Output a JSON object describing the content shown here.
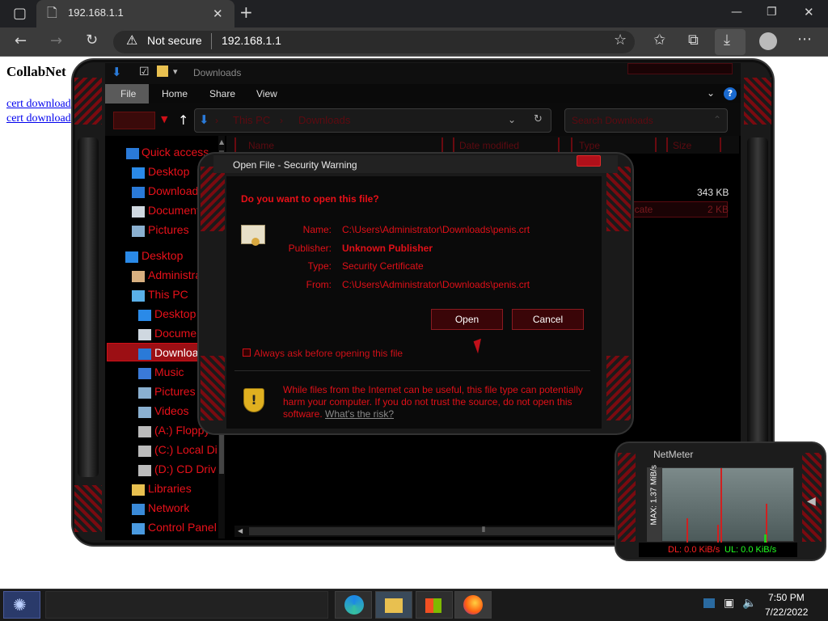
{
  "browser": {
    "tab_title": "192.168.1.1",
    "security_label": "Not secure",
    "url": "192.168.1.1"
  },
  "page": {
    "heading": "CollabNet",
    "links": [
      "cert download",
      "cert download"
    ]
  },
  "explorer": {
    "title": "Downloads",
    "ribbon_tabs": [
      "File",
      "Home",
      "Share",
      "View"
    ],
    "breadcrumb": [
      "This PC",
      "Downloads"
    ],
    "search_placeholder": "Search Downloads",
    "columns": [
      "Name",
      "Date modified",
      "Type",
      "Size"
    ],
    "nav_items": [
      {
        "label": "Quick access",
        "icon": "star-icon"
      },
      {
        "label": "Desktop",
        "icon": "desktop-icon"
      },
      {
        "label": "Downloads",
        "icon": "download-arrow-icon"
      },
      {
        "label": "Documents",
        "icon": "document-icon"
      },
      {
        "label": "Pictures",
        "icon": "pictures-icon"
      },
      {
        "label": "Desktop",
        "icon": "desktop-icon"
      },
      {
        "label": "Administrator",
        "icon": "user-icon"
      },
      {
        "label": "This PC",
        "icon": "computer-icon"
      },
      {
        "label": "Desktop",
        "icon": "desktop-icon"
      },
      {
        "label": "Documents",
        "icon": "document-icon"
      },
      {
        "label": "Downloads",
        "icon": "download-arrow-icon"
      },
      {
        "label": "Music",
        "icon": "music-icon"
      },
      {
        "label": "Pictures",
        "icon": "pictures-icon"
      },
      {
        "label": "Videos",
        "icon": "video-icon"
      },
      {
        "label": "(A:) Floppy",
        "icon": "floppy-icon"
      },
      {
        "label": "(C:) Local Disk",
        "icon": "disk-icon"
      },
      {
        "label": "(D:) CD Drive",
        "icon": "cd-icon"
      },
      {
        "label": "Libraries",
        "icon": "folder-icon"
      },
      {
        "label": "Network",
        "icon": "network-icon"
      },
      {
        "label": "Control Panel",
        "icon": "control-panel-icon"
      }
    ],
    "files": [
      {
        "type": "",
        "size": "343 KB"
      },
      {
        "type": "ificate",
        "size": "2 KB"
      }
    ]
  },
  "dialog": {
    "title": "Open File - Security Warning",
    "question": "Do you want to open this file?",
    "fields": [
      {
        "label": "Name:",
        "value": "C:\\Users\\Administrator\\Downloads\\penis.crt"
      },
      {
        "label": "Publisher:",
        "value": "Unknown Publisher"
      },
      {
        "label": "Type:",
        "value": "Security Certificate"
      },
      {
        "label": "From:",
        "value": "C:\\Users\\Administrator\\Downloads\\penis.crt"
      }
    ],
    "open_label": "Open",
    "cancel_label": "Cancel",
    "checkbox_label": "Always ask before opening this file",
    "warning_text": "While files from the Internet can be useful, this file type can potentially harm your computer. If you do not trust the source, do not open this software.",
    "risk_link": "What's the risk?"
  },
  "netmeter": {
    "title": "NetMeter",
    "axis_label": "MAX: 1.37 MiB/s",
    "dl": "DL: 0.0 KiB/s",
    "ul": "UL: 0.0 KiB/s"
  },
  "taskbar": {
    "time": "7:50 PM",
    "date": "7/22/2022",
    "apps": [
      "edge-icon",
      "file-explorer-icon",
      "store-icon",
      "firefox-icon"
    ]
  },
  "colors": {
    "accent_red": "#e0101a",
    "chrome_dark": "#202124"
  }
}
